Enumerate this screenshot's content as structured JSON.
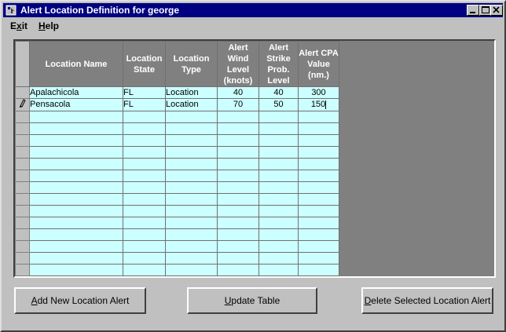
{
  "window": {
    "title": "Alert Location Definition for george"
  },
  "menu": {
    "exit_label": "Exit",
    "exit_accel": "x",
    "help_label": "Help",
    "help_accel": "H"
  },
  "grid": {
    "columns": [
      "Location Name",
      "Location State",
      "Location Type",
      "Alert Wind Level (knots)",
      "Alert Strike Prob. Level",
      "Alert CPA Value (nm.)"
    ],
    "rows": [
      [
        "Apalachicola",
        "FL",
        "Location",
        "40",
        "40",
        "300"
      ],
      [
        "Pensacola",
        "FL",
        "Location",
        "70",
        "50",
        "150"
      ]
    ],
    "edit_row_index": 1,
    "empty_rows": 14
  },
  "buttons": {
    "add_label": "Add New Location Alert",
    "update_label": "Update Table",
    "delete_label": "Delete Selected Location Alert"
  },
  "colors": {
    "titlebar": "#000080",
    "cell_bg": "#ccffff",
    "header_bg": "#808080",
    "face": "#c0c0c0"
  },
  "icons": {
    "app": "app-icon",
    "minimize": "minimize-icon",
    "maximize": "maximize-icon",
    "close": "close-icon",
    "edit_row": "pencil-icon"
  }
}
